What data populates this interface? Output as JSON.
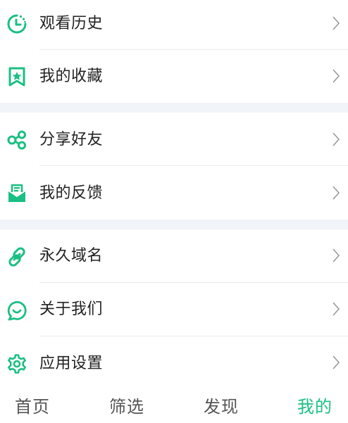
{
  "accent_color": "#1bbf83",
  "menu": {
    "history": {
      "label": "观看历史",
      "icon": "clock-icon"
    },
    "favorites": {
      "label": "我的收藏",
      "icon": "bookmark-star-icon"
    },
    "share": {
      "label": "分享好友",
      "icon": "share-icon"
    },
    "feedback": {
      "label": "我的反馈",
      "icon": "mail-feedback-icon"
    },
    "domain": {
      "label": "永久域名",
      "icon": "link-icon"
    },
    "about": {
      "label": "关于我们",
      "icon": "chat-smile-icon"
    },
    "settings": {
      "label": "应用设置",
      "icon": "gear-icon"
    }
  },
  "tabbar": {
    "tabs": [
      {
        "label": "首页",
        "active": false
      },
      {
        "label": "筛选",
        "active": false
      },
      {
        "label": "发现",
        "active": false
      },
      {
        "label": "我的",
        "active": true
      }
    ]
  }
}
